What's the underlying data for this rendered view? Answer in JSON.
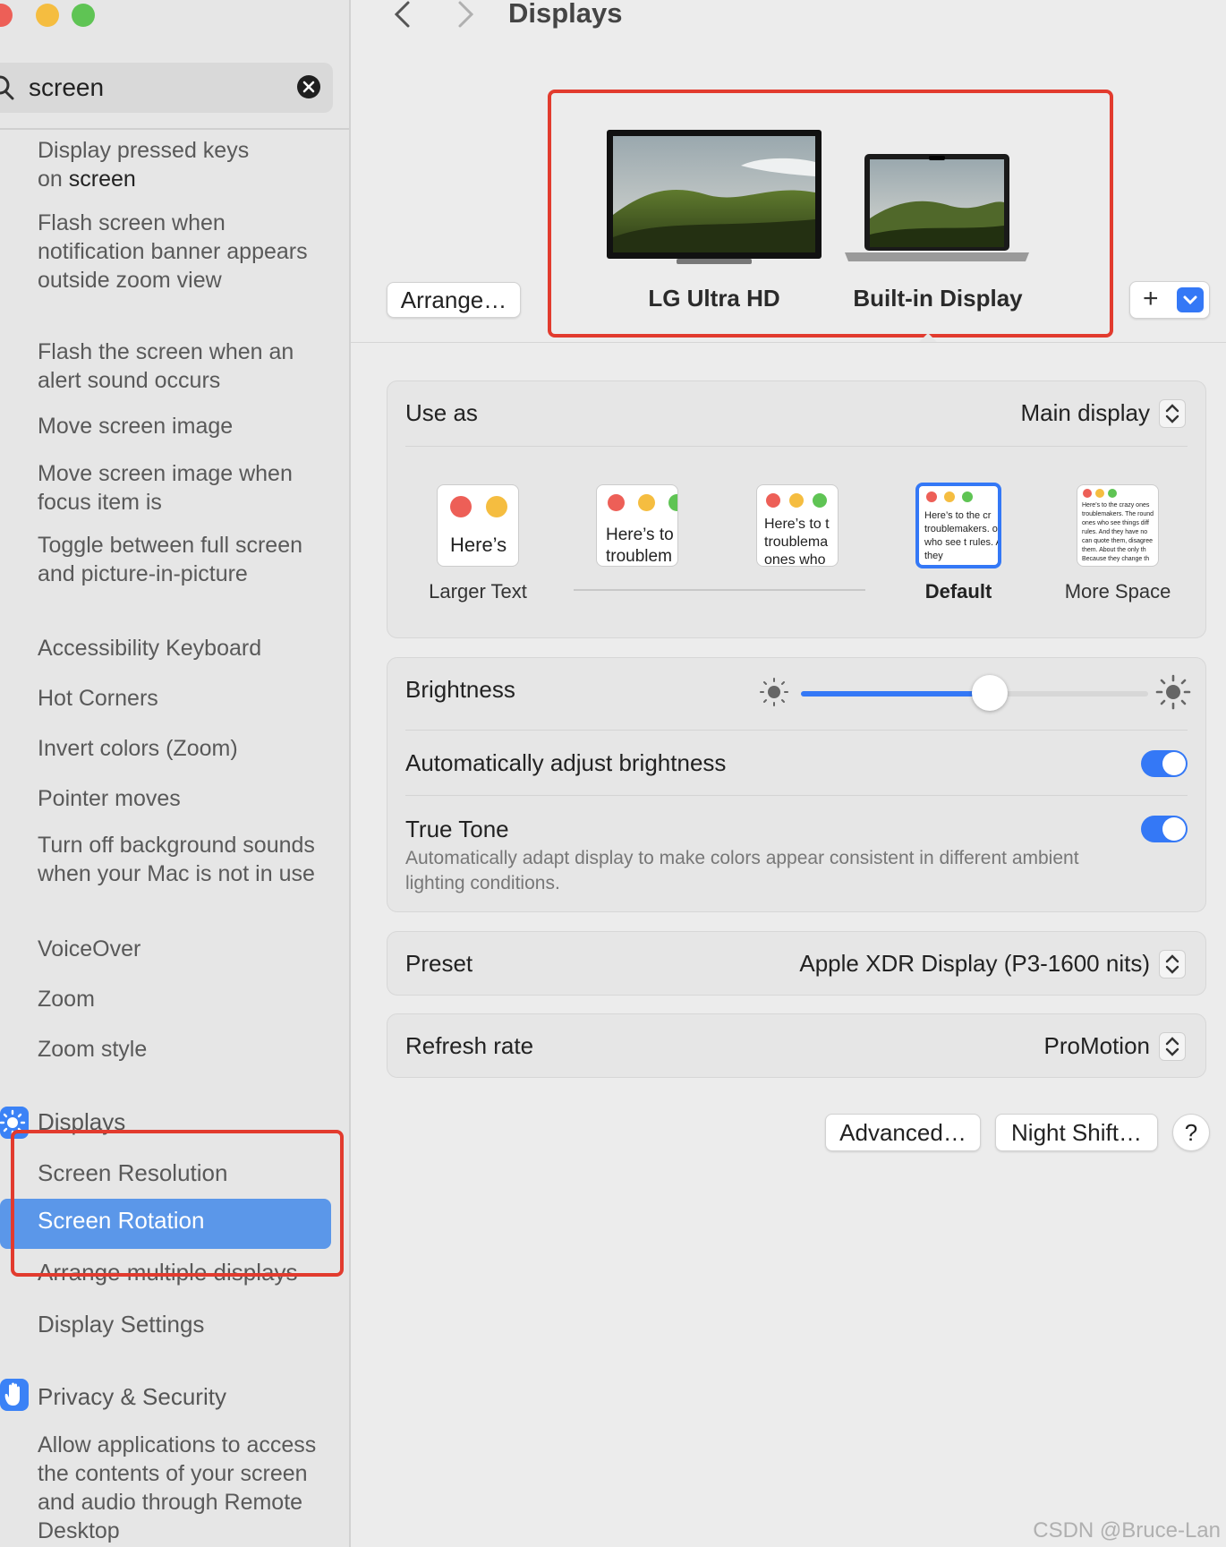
{
  "window": {
    "traffic_lights": {
      "close": "#ed5f57",
      "minimize": "#f5bd40",
      "zoom": "#5fc454"
    }
  },
  "search": {
    "value": "screen"
  },
  "sidebar": {
    "items": [
      {
        "pre": "Display pressed keys",
        "line2pre": "on ",
        "hl": "screen",
        "post": ""
      },
      {
        "text": "Flash screen when notification banner appears outside zoom view"
      },
      {
        "text": "Flash the screen when an alert sound occurs"
      },
      {
        "text": "Move screen image"
      },
      {
        "text": "Move screen image when focus item is"
      },
      {
        "text": "Toggle between full screen and picture-in-picture"
      },
      {
        "text": "Accessibility Keyboard"
      },
      {
        "text": "Hot Corners"
      },
      {
        "text": "Invert colors (Zoom)"
      },
      {
        "text": "Pointer moves"
      },
      {
        "text": "Turn off background sounds when your Mac is not in use"
      },
      {
        "text": "VoiceOver"
      },
      {
        "text": "Zoom"
      },
      {
        "text": "Zoom style"
      }
    ],
    "displays_section": "Displays",
    "displays_items": [
      "Screen Resolution",
      "Screen Rotation",
      "Arrange multiple displays",
      "Display Settings"
    ],
    "privacy_section": "Privacy & Security",
    "privacy_item": "Allow applications to access the contents of your screen and audio through Remote Desktop",
    "selected_color": "#5b97e9",
    "section_icon_color": "#3b82f6"
  },
  "header": {
    "title": "Displays",
    "arrange_button": "Arrange…",
    "displays": [
      "LG Ultra HD",
      "Built-in Display"
    ],
    "add_button": "+"
  },
  "use_as": {
    "label": "Use as",
    "value": "Main display",
    "sizes": [
      {
        "preview": "Here’s",
        "label": "Larger Text"
      },
      {
        "preview": "Here’s to troublem",
        "label": ""
      },
      {
        "preview": "Here’s to t troublema ones who",
        "label": ""
      },
      {
        "preview": "Here’s to the cr troublemakers. ones who see t rules. And they",
        "label": "Default"
      },
      {
        "preview": "Here’s to the crazy ones troublemakers. The round ones who see things diff rules. And they have no can quote them, disagree them. About the only th Because they change th",
        "label": "More Space"
      }
    ]
  },
  "brightness": {
    "label": "Brightness",
    "level": 0.55
  },
  "auto_brightness": {
    "label": "Automatically adjust brightness",
    "on": true
  },
  "true_tone": {
    "label": "True Tone",
    "description": "Automatically adapt display to make colors appear consistent in different ambient lighting conditions.",
    "on": true
  },
  "preset": {
    "label": "Preset",
    "value": "Apple XDR Display (P3-1600 nits)"
  },
  "refresh_rate": {
    "label": "Refresh rate",
    "value": "ProMotion"
  },
  "footer": {
    "advanced": "Advanced…",
    "night_shift": "Night Shift…",
    "help": "?"
  },
  "watermark": "CSDN @Bruce-Lan",
  "accent": "#3478f6",
  "highlight_box_color": "#e23b2e"
}
